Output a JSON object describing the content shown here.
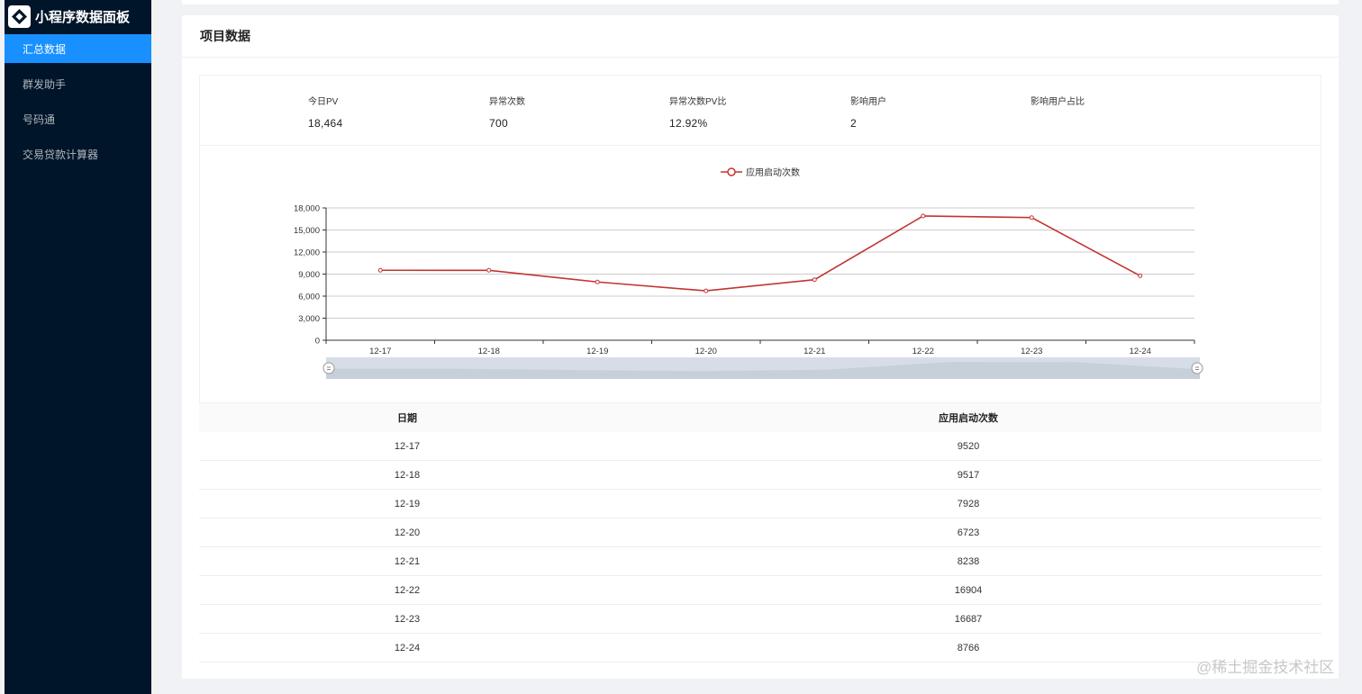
{
  "app": {
    "title": "小程序数据面板"
  },
  "menu": [
    {
      "label": "汇总数据",
      "active": true
    },
    {
      "label": "群发助手",
      "active": false
    },
    {
      "label": "号码通",
      "active": false
    },
    {
      "label": "交易贷款计算器",
      "active": false
    }
  ],
  "card": {
    "title": "项目数据"
  },
  "stats": [
    {
      "label": "今日PV",
      "value": "18,464"
    },
    {
      "label": "异常次数",
      "value": "700"
    },
    {
      "label": "异常次数PV比",
      "value": "12.92%"
    },
    {
      "label": "影响用户",
      "value": "2"
    },
    {
      "label": "影响用户占比",
      "value": ""
    }
  ],
  "chart_data": {
    "type": "line",
    "categories": [
      "12-17",
      "12-18",
      "12-19",
      "12-20",
      "12-21",
      "12-22",
      "12-23",
      "12-24"
    ],
    "series": [
      {
        "name": "应用启动次数",
        "values": [
          9520,
          9517,
          7928,
          6723,
          8238,
          16904,
          16687,
          8766
        ],
        "color": "#c23531"
      }
    ],
    "ylim": [
      0,
      18000
    ],
    "yticks": [
      0,
      3000,
      6000,
      9000,
      12000,
      15000,
      18000
    ],
    "ytick_labels": [
      "0",
      "3,000",
      "6,000",
      "9,000",
      "12,000",
      "15,000",
      "18,000"
    ],
    "legend": "top-center",
    "grid": true,
    "datazoom": true
  },
  "table": {
    "headers": [
      "日期",
      "应用启动次数"
    ],
    "rows": [
      [
        "12-17",
        "9520"
      ],
      [
        "12-18",
        "9517"
      ],
      [
        "12-19",
        "7928"
      ],
      [
        "12-20",
        "6723"
      ],
      [
        "12-21",
        "8238"
      ],
      [
        "12-22",
        "16904"
      ],
      [
        "12-23",
        "16687"
      ],
      [
        "12-24",
        "8766"
      ]
    ]
  },
  "watermark": "@稀土掘金技术社区",
  "colors": {
    "sidebar": "#001529",
    "accent": "#1890ff",
    "series": "#c23531"
  }
}
